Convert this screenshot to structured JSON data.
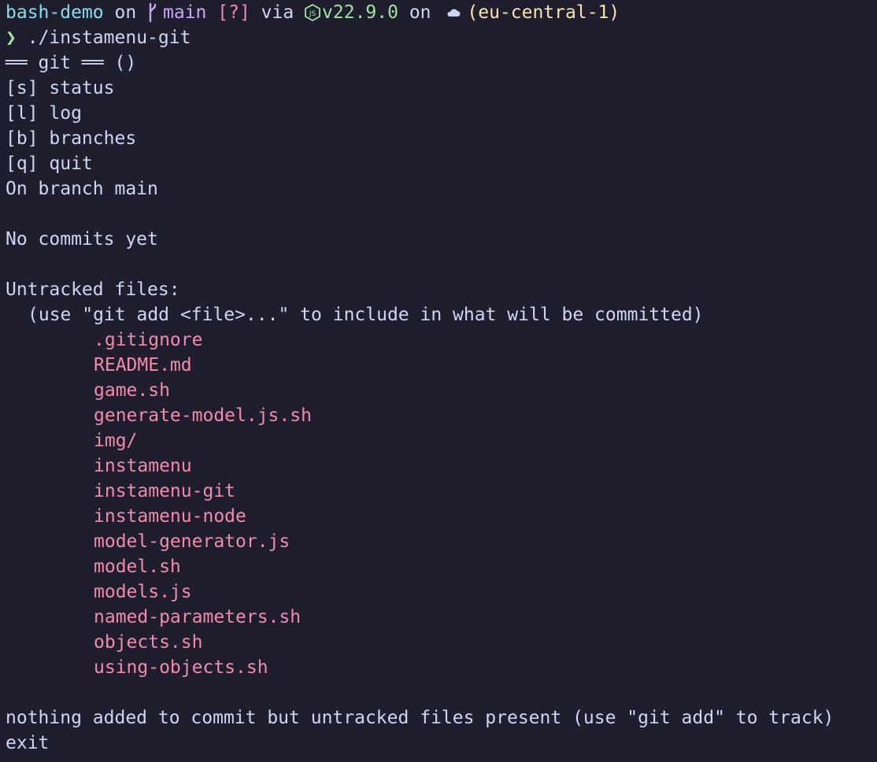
{
  "prompt": {
    "directory": "bash-demo",
    "on1": " on ",
    "branch": "main",
    "status": " [?]",
    "via": " via ",
    "node_version": "v22.9.0",
    "on2": " on ",
    "region": "(eu-central-1)",
    "icons": [
      "git-branch-icon",
      "nodejs-icon",
      "cloud-icon"
    ]
  },
  "command": {
    "symbol": "❯",
    "text": "./instamenu-git"
  },
  "menu": {
    "header": "══ git ══ ()",
    "items": [
      {
        "label": "[s] status"
      },
      {
        "label": "[l] log"
      },
      {
        "label": "[b] branches"
      },
      {
        "label": "[q] quit"
      }
    ]
  },
  "output": {
    "on_branch": "On branch main",
    "no_commits": "No commits yet",
    "untracked_header": "Untracked files:",
    "hint": "(use \"git add <file>...\" to include in what will be committed)",
    "files": [
      ".gitignore",
      "README.md",
      "game.sh",
      "generate-model.js.sh",
      "img/",
      "instamenu",
      "instamenu-git",
      "instamenu-node",
      "model-generator.js",
      "model.sh",
      "models.js",
      "named-parameters.sh",
      "objects.sh",
      "using-objects.sh"
    ],
    "nothing_added": "nothing added to commit but untracked files present (use \"git add\" to track)",
    "exit": "exit"
  },
  "colors": {
    "background": "#1e1e2e",
    "foreground": "#cdd6f4",
    "directory": "#89dceb",
    "branch": "#cba6f7",
    "untracked": "#f38ba8",
    "node": "#a6e3a1",
    "region": "#f9e2af"
  }
}
